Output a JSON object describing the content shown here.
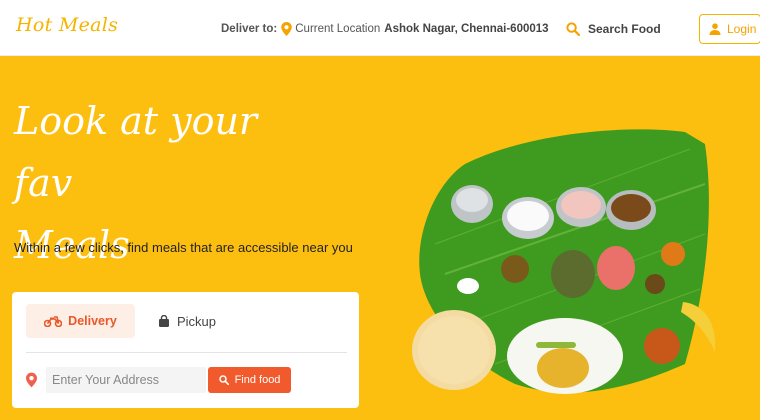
{
  "brand": {
    "name": "Hot Meals"
  },
  "header": {
    "deliver_label": "Deliver to:",
    "current_location_label": "Current Location",
    "area": "Ashok Nagar, Chennai-600013",
    "search_label": "Search Food",
    "login_label": "Login"
  },
  "hero": {
    "headline_line1": "Look at your fav",
    "headline_line2": "Meals",
    "subtext": "Within a few clicks, find meals that are accessible near you"
  },
  "search_card": {
    "tabs": [
      {
        "label": "Delivery",
        "active": true,
        "icon": "motorbike-icon"
      },
      {
        "label": "Pickup",
        "active": false,
        "icon": "shopping-bag-icon"
      }
    ],
    "address_placeholder": "Enter Your Address",
    "find_button_label": "Find food"
  },
  "colors": {
    "brand_yellow": "#fdbf0f",
    "logo_yellow": "#f5b400",
    "accent_orange": "#f05a2c",
    "delivery_tab_bg": "#fdeee6"
  }
}
